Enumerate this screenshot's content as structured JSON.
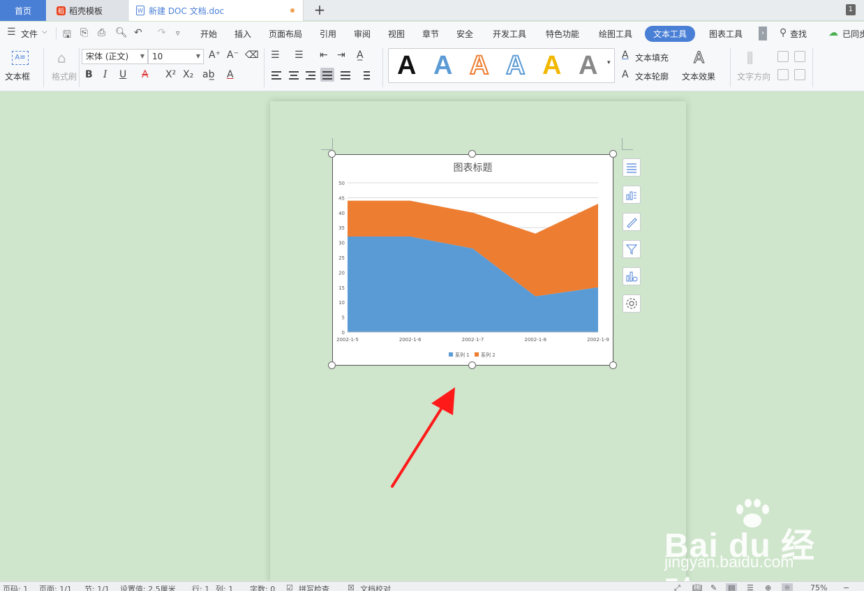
{
  "tabs": {
    "home": "首页",
    "template": "稻壳模板",
    "document": "新建 DOC 文档.doc",
    "add": "+",
    "window_count": "1"
  },
  "menu": {
    "file": "文件",
    "items": [
      "开始",
      "插入",
      "页面布局",
      "引用",
      "审阅",
      "视图",
      "章节",
      "安全",
      "开发工具",
      "特色功能",
      "绘图工具",
      "文本工具",
      "图表工具"
    ],
    "active": "文本工具",
    "search": "查找",
    "sync": "已同步"
  },
  "ribbon": {
    "textbox": "文本框",
    "format_painter": "格式刷",
    "font_name": "宋体 (正文)",
    "font_size": "10",
    "text_fill": "文本填充",
    "text_outline": "文本轮廓",
    "text_effect": "文本效果",
    "text_direction": "文字方向",
    "style_letter": "A"
  },
  "colors": {
    "series1": "#5b9bd5",
    "series2": "#ed7d31",
    "accent": "#4a7fd6",
    "arrow": "#ff1a1a"
  },
  "chart_data": {
    "type": "area",
    "stacked": true,
    "title": "图表标题",
    "categories": [
      "2002-1-5",
      "2002-1-6",
      "2002-1-7",
      "2002-1-8",
      "2002-1-9"
    ],
    "series": [
      {
        "name": "系列 1",
        "values": [
          32,
          32,
          28,
          12,
          15
        ]
      },
      {
        "name": "系列 2",
        "values": [
          12,
          12,
          12,
          21,
          28
        ]
      }
    ],
    "ylim": [
      0,
      50
    ],
    "yticks": [
      0,
      5,
      10,
      15,
      20,
      25,
      30,
      35,
      40,
      45,
      50
    ],
    "grid": true,
    "legend": "bottom"
  },
  "statusbar": {
    "page_no": "页码: 1",
    "pages": "页面: 1/1",
    "section": "节: 1/1",
    "setting": "设置值: 2.5厘米",
    "row": "行: 1",
    "col": "列: 1",
    "words": "字数: 0",
    "spell": "拼写检查",
    "proof": "文档校对",
    "zoom": "75%"
  },
  "watermark": {
    "brand": "Bai du 经验",
    "url": "jingyan.baidu.com"
  }
}
